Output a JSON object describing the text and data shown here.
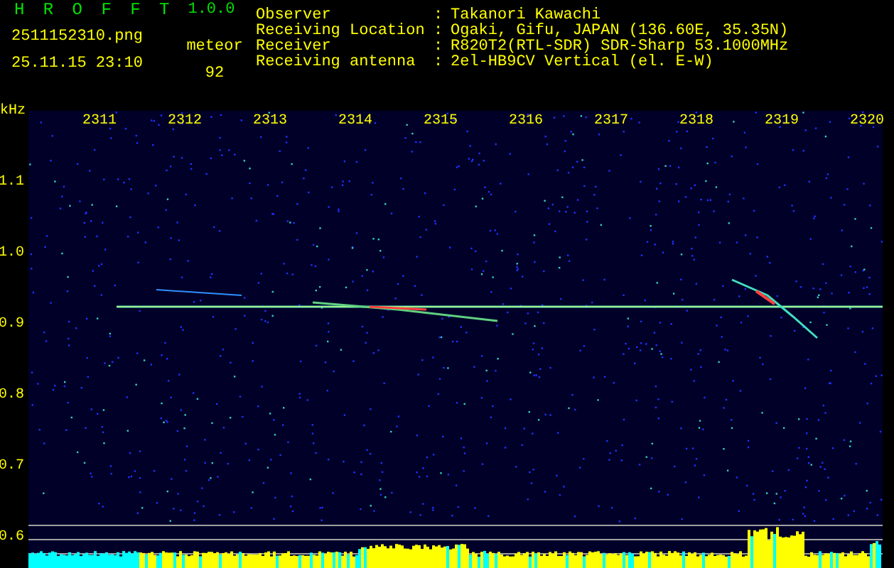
{
  "header": {
    "app_name": "H R O F F T",
    "version": "1.0.0",
    "filename": "2511152310.png",
    "datetime": "25.11.15 23:10",
    "meteor_label": "meteor",
    "meteor_count": "92"
  },
  "info": [
    {
      "label": "Observer",
      "separator": ":",
      "value": "Takanori Kawachi"
    },
    {
      "label": "Receiving Location",
      "separator": ":",
      "value": "Ogaki, Gifu, JAPAN (136.60E, 35.35N)"
    },
    {
      "label": "Receiver",
      "separator": ":",
      "value": "R820T2(RTL-SDR) SDR-Sharp 53.1000MHz"
    },
    {
      "label": "Receiving antenna",
      "separator": ":",
      "value": "2el-HB9CV Vertical (el. E-W)"
    }
  ],
  "spectrogram": {
    "y_unit": "kHz",
    "x_labels": [
      "2311",
      "2312",
      "2313",
      "2314",
      "2315",
      "2316",
      "2317",
      "2318",
      "2319",
      "2320"
    ],
    "y_labels": [
      "1.1",
      "1.0",
      "0.9",
      "0.8",
      "0.7",
      "0.6"
    ]
  }
}
